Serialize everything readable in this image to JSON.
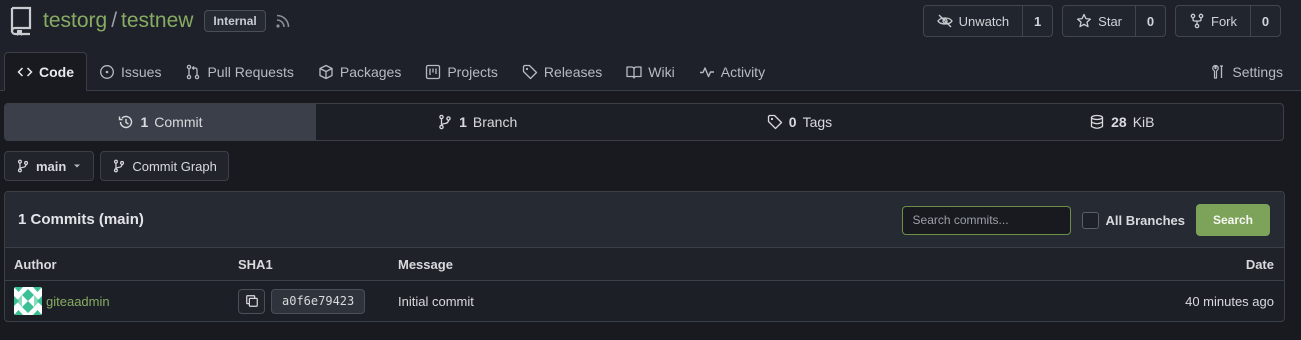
{
  "repo": {
    "owner": "testorg",
    "separator": "/",
    "name": "testnew",
    "visibility_badge": "Internal"
  },
  "actions": {
    "unwatch": {
      "label": "Unwatch",
      "count": "1"
    },
    "star": {
      "label": "Star",
      "count": "0"
    },
    "fork": {
      "label": "Fork",
      "count": "0"
    }
  },
  "tabs": [
    {
      "label": "Code",
      "icon": "code-icon",
      "active": true
    },
    {
      "label": "Issues",
      "icon": "issue-icon"
    },
    {
      "label": "Pull Requests",
      "icon": "pull-request-icon"
    },
    {
      "label": "Packages",
      "icon": "package-icon"
    },
    {
      "label": "Projects",
      "icon": "project-icon"
    },
    {
      "label": "Releases",
      "icon": "tag-icon"
    },
    {
      "label": "Wiki",
      "icon": "book-icon"
    },
    {
      "label": "Activity",
      "icon": "pulse-icon"
    }
  ],
  "settings_tab": {
    "label": "Settings",
    "icon": "tools-icon"
  },
  "stats": {
    "commits": {
      "count": "1",
      "label": "Commit"
    },
    "branches": {
      "count": "1",
      "label": "Branch"
    },
    "tags": {
      "count": "0",
      "label": "Tags"
    },
    "size": {
      "count": "28",
      "label": "KiB"
    }
  },
  "branch_selector": {
    "value": "main"
  },
  "commit_graph": {
    "label": "Commit Graph"
  },
  "commits": {
    "title": "1 Commits (main)",
    "search_placeholder": "Search commits...",
    "all_branches_label": "All Branches",
    "search_button": "Search",
    "columns": {
      "author": "Author",
      "sha": "SHA1",
      "message": "Message",
      "date": "Date"
    },
    "rows": [
      {
        "author": "giteaadmin",
        "sha": "a0f6e79423",
        "message": "Initial commit",
        "date": "40 minutes ago"
      }
    ]
  },
  "colors": {
    "accent_green": "#87ab63",
    "button_green": "#7da35a",
    "background": "#181a20"
  }
}
